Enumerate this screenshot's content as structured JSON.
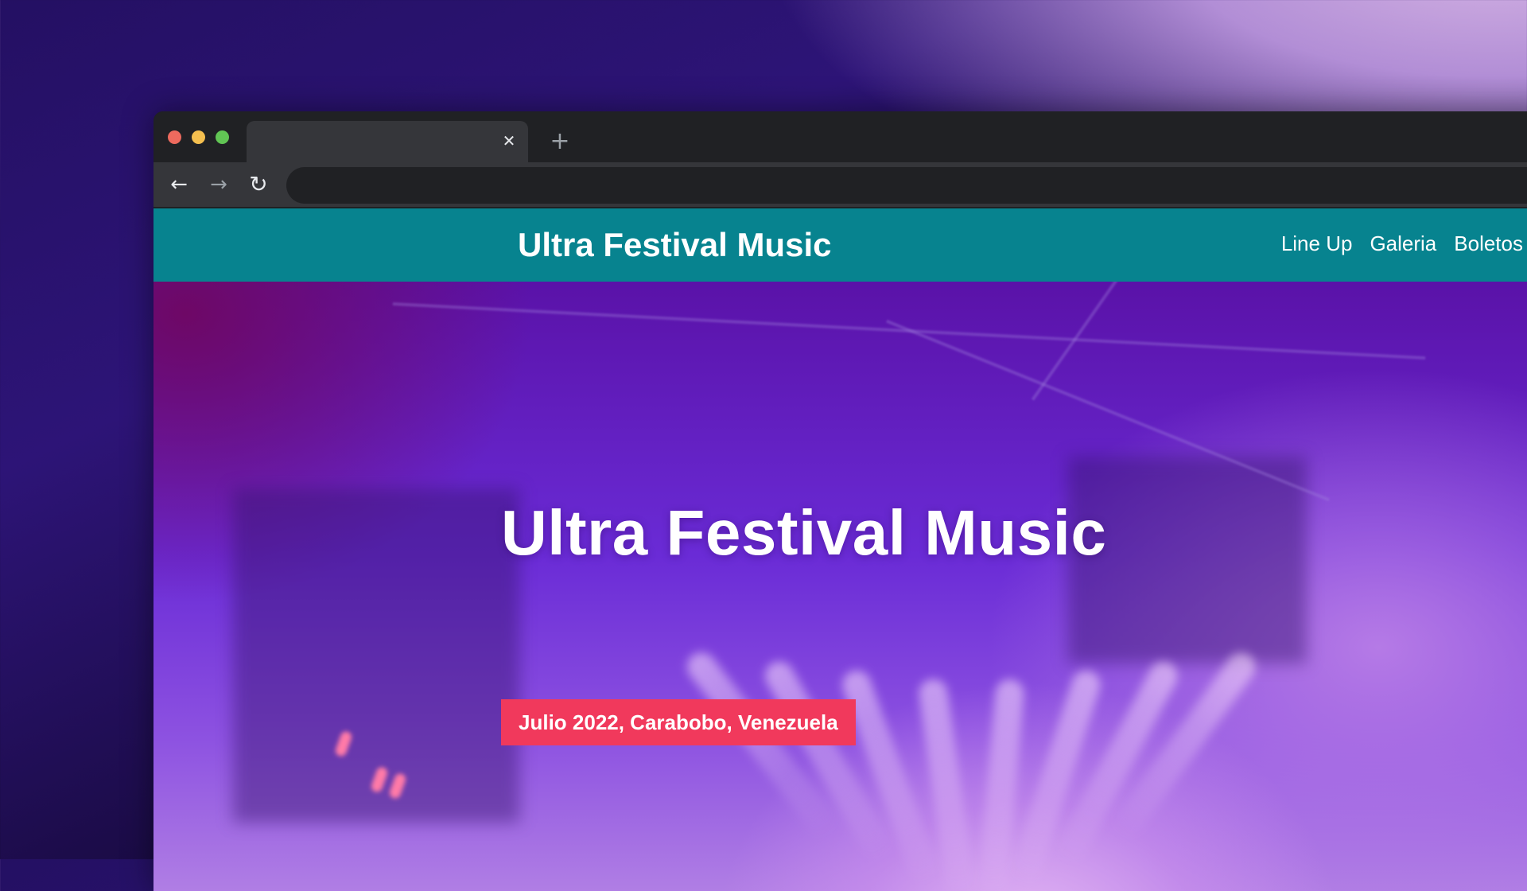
{
  "browser": {
    "tab": {
      "close_glyph": "✕"
    },
    "new_tab_glyph": "+",
    "nav": {
      "back_glyph": "←",
      "forward_glyph": "→",
      "reload_glyph": "↻"
    }
  },
  "site": {
    "logo": "Ultra Festival Music",
    "nav": [
      {
        "label": "Line Up"
      },
      {
        "label": "Galeria"
      },
      {
        "label": "Boletos"
      }
    ],
    "hero": {
      "title": "Ultra Festival Music",
      "subtitle": "Julio 2022, Carabobo, Venezuela"
    }
  },
  "colors": {
    "header_bg": "#07838f",
    "badge_bg": "#f1395c",
    "traffic_red": "#ed6a5e",
    "traffic_yellow": "#f4bf4f",
    "traffic_green": "#61c554"
  }
}
